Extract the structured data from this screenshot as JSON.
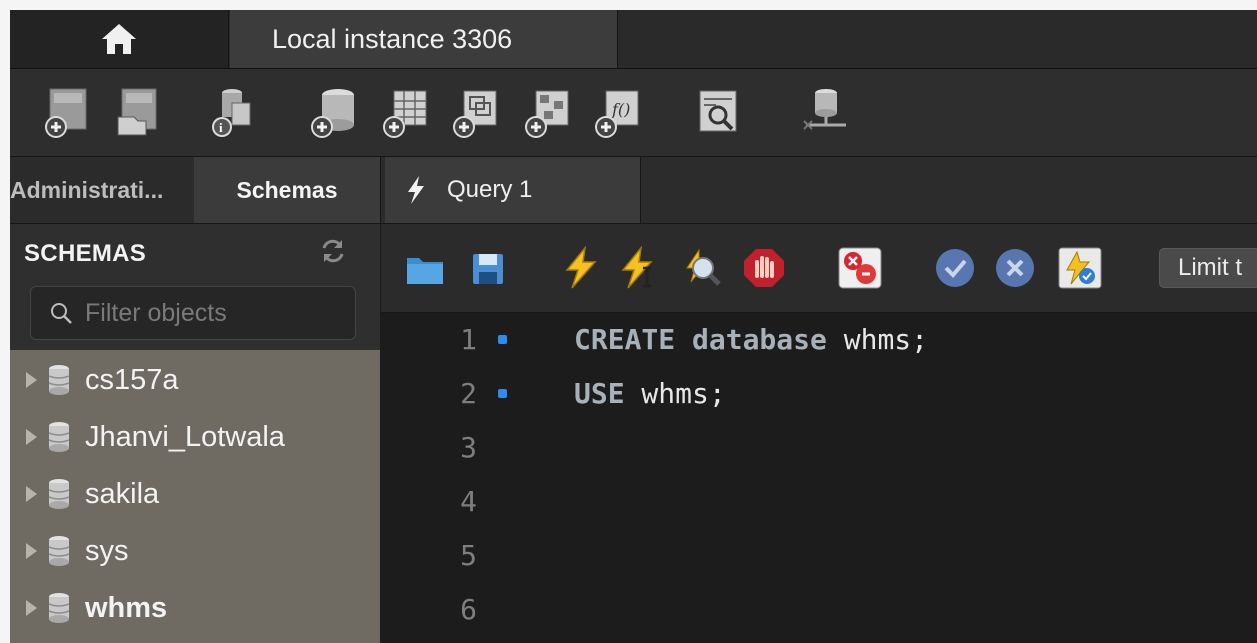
{
  "connection_tab": {
    "title": "Local instance 3306"
  },
  "main_toolbar": {
    "buttons": [
      "new-sql-tab-icon",
      "open-sql-script-icon",
      "inspect-schema-icon",
      "create-schema-icon",
      "create-table-icon",
      "create-view-icon",
      "create-procedure-icon",
      "create-function-icon",
      "search-table-data-icon",
      "reconnect-icon"
    ]
  },
  "sidebar": {
    "tabs": [
      "Administrati...",
      "Schemas"
    ],
    "active_tab": "Schemas",
    "heading": "SCHEMAS",
    "filter_placeholder": "Filter objects",
    "schemas": [
      {
        "name": "cs157a",
        "bold": false
      },
      {
        "name": "Jhanvi_Lotwala",
        "bold": false
      },
      {
        "name": "sakila",
        "bold": false
      },
      {
        "name": "sys",
        "bold": false
      },
      {
        "name": "whms",
        "bold": true
      }
    ]
  },
  "query_tab": {
    "label": "Query 1"
  },
  "editor_toolbar": {
    "buttons": [
      "open-file-icon",
      "save-icon",
      "execute-icon",
      "execute-current-icon",
      "explain-icon",
      "stop-icon",
      "toggle-continue-on-error-icon",
      "commit-icon",
      "rollback-icon",
      "autocommit-icon"
    ],
    "limit_label": "Limit t"
  },
  "editor": {
    "lines": [
      {
        "number": "1",
        "keyword": "CREATE database",
        "rest": " whms;",
        "marker": true
      },
      {
        "number": "2",
        "keyword": "USE",
        "rest": " whms;",
        "marker": true
      },
      {
        "number": "3",
        "keyword": "",
        "rest": "",
        "marker": false
      },
      {
        "number": "4",
        "keyword": "",
        "rest": "",
        "marker": false
      },
      {
        "number": "5",
        "keyword": "",
        "rest": "",
        "marker": false
      },
      {
        "number": "6",
        "keyword": "",
        "rest": "",
        "marker": false
      }
    ]
  },
  "colors": {
    "accent_marker": "#2b8ded",
    "sidebar_list_bg": "#6f6a62",
    "editor_bg": "#1c1c1c"
  }
}
